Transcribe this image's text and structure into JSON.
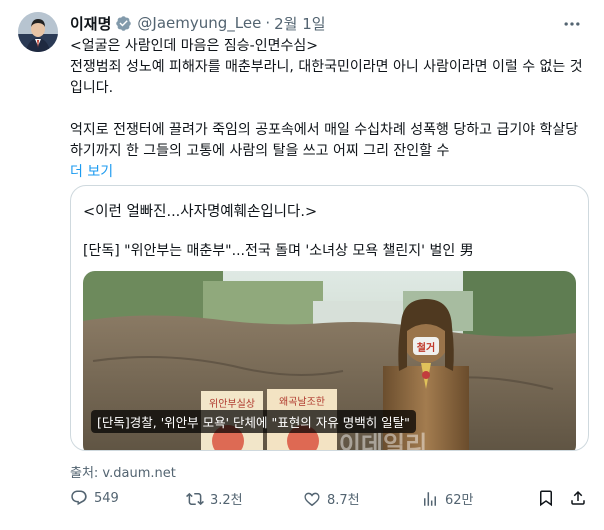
{
  "tweet": {
    "author_name": "이재명",
    "handle": "@Jaemyung_Lee",
    "separator": "·",
    "date": "2월 1일",
    "text_line1": "<얼굴은 사람인데 마음은 짐승-인면수심>",
    "text_line2": "전쟁범죄 성노예 피해자를 매춘부라니, 대한국민이라면 아니 사람이라면 이럴 수 없는 것입니다.",
    "text_line3": "억지로 전쟁터에 끌려가 죽임의 공포속에서 매일 수십차례 성폭행 당하고 급기야 학살당하기까지 한 그들의 고통에 사람의 탈을 쓰고 어찌 그리 잔인할 수",
    "show_more": "더 보기"
  },
  "card": {
    "quote": "<이런 얼빠진...사자명예훼손입니다.>",
    "title": "[단독] \"위안부는 매춘부\"...전국 돌며 '소녀상 모욕 챌린지' 벌인 男",
    "image_caption": "[단독]경찰, '위안부 모욕' 단체에 \"표현의 자유 명백히 일탈\"",
    "sign_text_top": "위안부실상",
    "sign_text_top2": "왜곡날조한",
    "mask_text": "철거",
    "watermark": "이데일리"
  },
  "source": "출처: v.daum.net",
  "actions": {
    "replies": "549",
    "retweets": "3.2천",
    "likes": "8.7천",
    "views": "62만"
  },
  "colors": {
    "accent": "#1d9bf0",
    "muted": "#536471",
    "border": "#cfd9de"
  },
  "icons": {
    "verified": "verified-badge-icon",
    "more": "more-horizontal-icon",
    "reply": "reply-icon",
    "retweet": "retweet-icon",
    "like": "heart-icon",
    "views": "views-chart-icon",
    "bookmark": "bookmark-icon",
    "share": "share-icon"
  }
}
